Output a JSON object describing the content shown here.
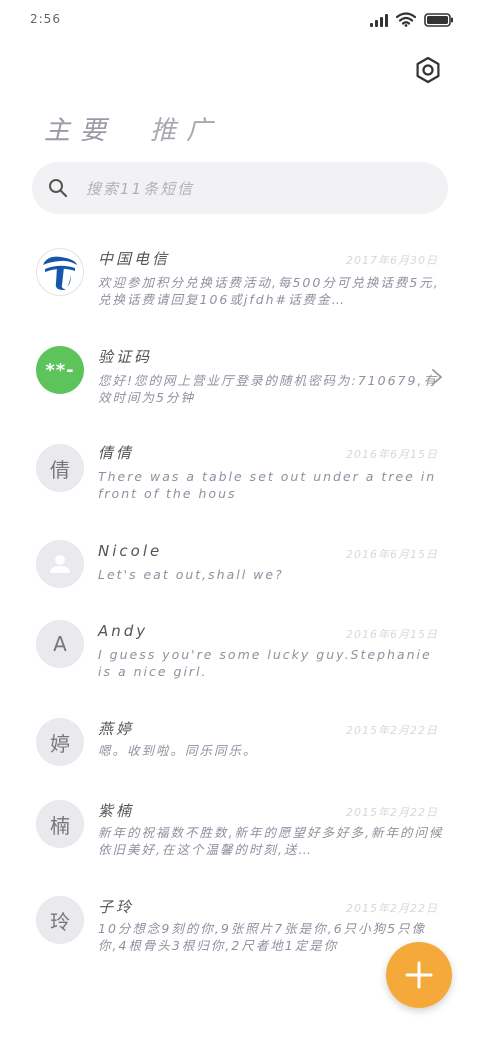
{
  "status_bar": {
    "time": "2:56"
  },
  "tabs": [
    {
      "label": "主要",
      "active": true
    },
    {
      "label": "推广",
      "active": false
    }
  ],
  "search": {
    "placeholder": "搜索11条短信"
  },
  "messages": [
    {
      "sender": "中国电信",
      "date": "2017年6月30日",
      "preview": "欢迎参加积分兑换话费活动,每500分可兑换话费5元,兑换话费请回复106或jfdh#话费金…",
      "avatar": "telecom-logo"
    },
    {
      "sender": "验证码",
      "date": "",
      "preview": "您好!您的网上营业厅登录的随机密码为:710679,有效时间为5分钟",
      "avatar_text": "**-"
    },
    {
      "sender": "倩倩",
      "date": "2016年6月15日",
      "preview": "There was a table set out under a tree in front of the hous",
      "avatar_text": "倩"
    },
    {
      "sender": "Nicole",
      "date": "2016年6月15日",
      "preview": "Let's eat out,shall we?",
      "avatar": "person-placeholder"
    },
    {
      "sender": "Andy",
      "date": "2016年6月15日",
      "preview": "I guess you're some lucky guy.Stephanie is a nice girl.",
      "avatar_text": "A"
    },
    {
      "sender": "燕婷",
      "date": "2015年2月22日",
      "preview": "嗯。收到啦。同乐同乐。",
      "avatar_text": "婷"
    },
    {
      "sender": "紫楠",
      "date": "2015年2月22日",
      "preview": "新年的祝福数不胜数,新年的愿望好多好多,新年的问候依旧美好,在这个温馨的时刻,送…",
      "avatar_text": "楠"
    },
    {
      "sender": "子玲",
      "date": "2015年2月22日",
      "preview": "10分想念9刻的你,9张照片7张是你,6只小狗5只像你,4根骨头3根归你,2尺者地1定是你",
      "avatar_text": "玲"
    }
  ],
  "colors": {
    "accent": "#f5a93a",
    "green": "#5cc45a",
    "telecom_blue": "#1556a8"
  }
}
